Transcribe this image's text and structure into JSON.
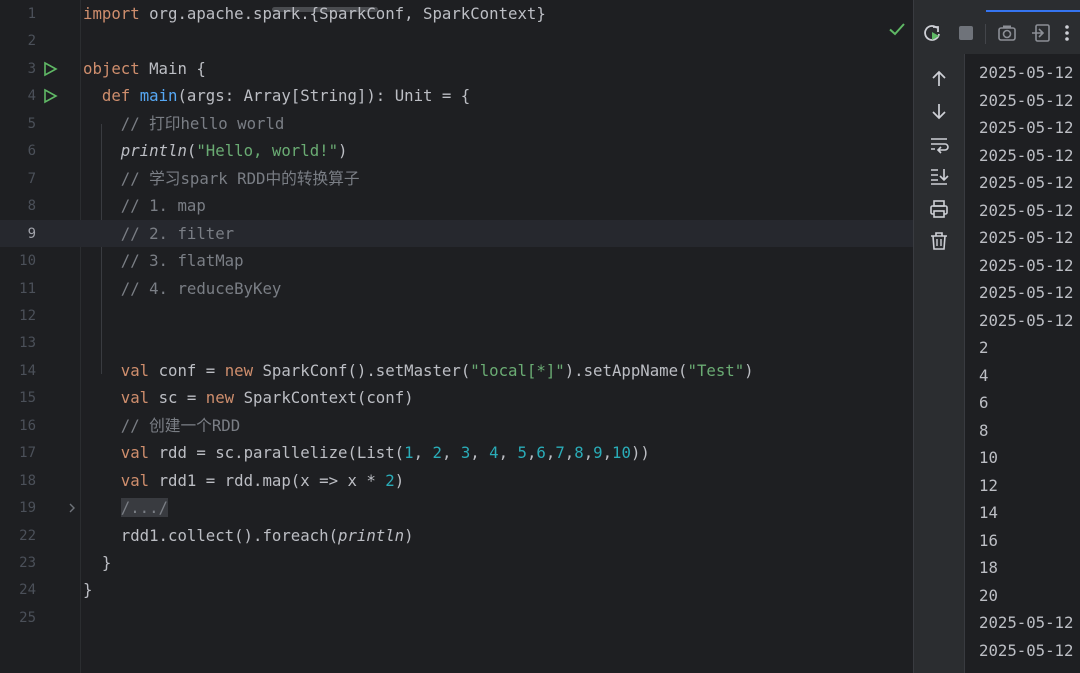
{
  "editor": {
    "current_line": "9",
    "lines": [
      {
        "num": "1",
        "tokens": [
          {
            "t": "import",
            "c": "kw"
          },
          {
            "t": " org.apache.spark.{SparkConf, SparkContext}",
            "c": "tx"
          }
        ]
      },
      {
        "num": "2",
        "tokens": []
      },
      {
        "num": "3",
        "run": true,
        "tokens": [
          {
            "t": "object",
            "c": "kw"
          },
          {
            "t": " Main {",
            "c": "tx"
          }
        ]
      },
      {
        "num": "4",
        "run": true,
        "tokens": [
          {
            "t": "  "
          },
          {
            "t": "def",
            "c": "kw"
          },
          {
            "t": " "
          },
          {
            "t": "main",
            "c": "fn"
          },
          {
            "t": "(args: Array[String]): Unit = {",
            "c": "tx"
          }
        ]
      },
      {
        "num": "5",
        "tokens": [
          {
            "t": "    "
          },
          {
            "t": "// 打印hello world",
            "c": "cm"
          }
        ]
      },
      {
        "num": "6",
        "tokens": [
          {
            "t": "    "
          },
          {
            "t": "println",
            "c": "it"
          },
          {
            "t": "(",
            "c": "tx"
          },
          {
            "t": "\"Hello, world!\"",
            "c": "st"
          },
          {
            "t": ")",
            "c": "tx"
          }
        ]
      },
      {
        "num": "7",
        "tokens": [
          {
            "t": "    "
          },
          {
            "t": "// 学习spark RDD中的转换算子",
            "c": "cm"
          }
        ]
      },
      {
        "num": "8",
        "tokens": [
          {
            "t": "    "
          },
          {
            "t": "// 1. map",
            "c": "cm"
          }
        ]
      },
      {
        "num": "9",
        "tokens": [
          {
            "t": "    "
          },
          {
            "t": "// 2. filter",
            "c": "cm"
          }
        ]
      },
      {
        "num": "10",
        "tokens": [
          {
            "t": "    "
          },
          {
            "t": "// 3. flatMap",
            "c": "cm"
          }
        ]
      },
      {
        "num": "11",
        "tokens": [
          {
            "t": "    "
          },
          {
            "t": "// 4. reduceByKey",
            "c": "cm"
          }
        ]
      },
      {
        "num": "12",
        "tokens": []
      },
      {
        "num": "13",
        "tokens": []
      },
      {
        "num": "14",
        "tokens": [
          {
            "t": "    "
          },
          {
            "t": "val",
            "c": "kw"
          },
          {
            "t": " conf = ",
            "c": "tx"
          },
          {
            "t": "new",
            "c": "kw"
          },
          {
            "t": " SparkConf().setMaster(",
            "c": "tx"
          },
          {
            "t": "\"local[*]\"",
            "c": "st"
          },
          {
            "t": ").setAppName(",
            "c": "tx"
          },
          {
            "t": "\"Test\"",
            "c": "st"
          },
          {
            "t": ")",
            "c": "tx"
          }
        ]
      },
      {
        "num": "15",
        "tokens": [
          {
            "t": "    "
          },
          {
            "t": "val",
            "c": "kw"
          },
          {
            "t": " sc = ",
            "c": "tx"
          },
          {
            "t": "new",
            "c": "kw"
          },
          {
            "t": " SparkContext(conf)",
            "c": "tx"
          }
        ]
      },
      {
        "num": "16",
        "tokens": [
          {
            "t": "    "
          },
          {
            "t": "// 创建一个RDD",
            "c": "cm"
          }
        ]
      },
      {
        "num": "17",
        "tokens": [
          {
            "t": "    "
          },
          {
            "t": "val",
            "c": "kw"
          },
          {
            "t": " rdd = sc.parallelize(List(",
            "c": "tx"
          },
          {
            "t": "1",
            "c": "nm"
          },
          {
            "t": ", ",
            "c": "tx"
          },
          {
            "t": "2",
            "c": "nm"
          },
          {
            "t": ", ",
            "c": "tx"
          },
          {
            "t": "3",
            "c": "nm"
          },
          {
            "t": ", ",
            "c": "tx"
          },
          {
            "t": "4",
            "c": "nm"
          },
          {
            "t": ", ",
            "c": "tx"
          },
          {
            "t": "5",
            "c": "nm"
          },
          {
            "t": ",",
            "c": "tx"
          },
          {
            "t": "6",
            "c": "nm"
          },
          {
            "t": ",",
            "c": "tx"
          },
          {
            "t": "7",
            "c": "nm"
          },
          {
            "t": ",",
            "c": "tx"
          },
          {
            "t": "8",
            "c": "nm"
          },
          {
            "t": ",",
            "c": "tx"
          },
          {
            "t": "9",
            "c": "nm"
          },
          {
            "t": ",",
            "c": "tx"
          },
          {
            "t": "10",
            "c": "nm"
          },
          {
            "t": "))",
            "c": "tx"
          }
        ]
      },
      {
        "num": "18",
        "tokens": [
          {
            "t": "    "
          },
          {
            "t": "val",
            "c": "kw"
          },
          {
            "t": " rdd1 = rdd.map(x => x * ",
            "c": "tx"
          },
          {
            "t": "2",
            "c": "nm"
          },
          {
            "t": ")",
            "c": "tx"
          }
        ]
      },
      {
        "num": "19",
        "fold": true,
        "tokens": [
          {
            "t": "    "
          },
          {
            "t": "/.../",
            "c": "fold"
          }
        ]
      },
      {
        "num": "22",
        "tokens": [
          {
            "t": "    "
          },
          {
            "t": "rdd1.collect().foreach(",
            "c": "tx"
          },
          {
            "t": "println",
            "c": "it"
          },
          {
            "t": ")",
            "c": "tx"
          }
        ]
      },
      {
        "num": "23",
        "tokens": [
          {
            "t": "  }",
            "c": "tx"
          }
        ]
      },
      {
        "num": "24",
        "tokens": [
          {
            "t": "}",
            "c": "tx"
          }
        ]
      },
      {
        "num": "25",
        "tokens": []
      }
    ]
  },
  "console_lines": [
    "2025-05-12",
    "2025-05-12",
    "2025-05-12",
    "2025-05-12",
    "2025-05-12",
    "2025-05-12",
    "2025-05-12",
    "2025-05-12",
    "2025-05-12",
    "2025-05-12",
    "2",
    "4",
    "6",
    "8",
    "10",
    "12",
    "14",
    "16",
    "18",
    "20",
    "2025-05-12",
    "2025-05-12"
  ],
  "colors": {
    "kw": "#cf8e6d",
    "tx": "#bcbec4",
    "fn": "#56a8f5",
    "cm": "#7a7e85",
    "st": "#6aab73",
    "nm": "#2aacb8",
    "it": "#bcbec4",
    "fold": "#7a7e85",
    "accent": "#3574f0",
    "run": "#5fb865"
  },
  "toolbar_icons": [
    "rerun-icon",
    "stop-icon",
    "screenshot-icon",
    "exit-icon",
    "more-icon"
  ],
  "side_tool_icons": [
    "up-arrow-icon",
    "down-arrow-icon",
    "soft-wrap-icon",
    "scroll-to-end-icon",
    "print-icon",
    "trash-icon"
  ]
}
